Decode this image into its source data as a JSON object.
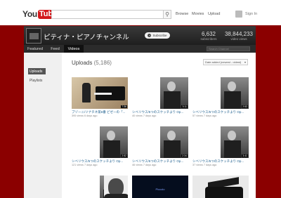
{
  "topbar": {
    "logo_you": "You",
    "logo_tube": "Tube",
    "search_placeholder": "",
    "nav": [
      "Browse",
      "Movies",
      "Upload"
    ],
    "signin": "Sign In"
  },
  "channel": {
    "title": "ピティナ・ピアノチャンネル",
    "subscribe_label": "Subscribe",
    "stats": [
      {
        "value": "6,632",
        "label": "subscribers"
      },
      {
        "value": "38,844,233",
        "label": "video views"
      }
    ],
    "tabs": [
      "Featured",
      "Feed",
      "Videos"
    ],
    "active_tab": "Videos",
    "search_placeholder": "Search Channel"
  },
  "sidebar": {
    "items": [
      "Uploads",
      "Playlists"
    ],
    "active": "Uploads"
  },
  "main": {
    "title": "Uploads",
    "count": "(5,186)",
    "sort_label": "Date added (newest - oldest)"
  },
  "videos": [
    {
      "title": "ブゾーニ/ソナチネ第6番 ビゼーの「...",
      "views": "395 views",
      "age": "6 days ago",
      "duration": "7:36",
      "thumb": "piano"
    },
    {
      "title": "シベリウス/5つのスケッチより Op...",
      "views": "40 views",
      "age": "7 days ago",
      "duration": "3:11",
      "thumb": "split"
    },
    {
      "title": "シベリウス/5つのスケッチより Op...",
      "views": "57 views",
      "age": "7 days ago",
      "duration": "2:53",
      "thumb": "split"
    },
    {
      "title": "シベリウス/5つのスケッチより Op...",
      "views": "121 views",
      "age": "7 days ago",
      "duration": "2:52",
      "thumb": "split"
    },
    {
      "title": "シベリウス/5つのスケッチより Op...",
      "views": "46 views",
      "age": "7 days ago",
      "duration": "2:34",
      "thumb": "split"
    },
    {
      "title": "シベリウス/5つのスケッチより Op...",
      "views": "37 views",
      "age": "7 days ago",
      "duration": "3:41",
      "thumb": "split"
    },
    {
      "title": "",
      "views": "",
      "age": "",
      "duration": "",
      "thumb": "split"
    },
    {
      "title": "",
      "views": "",
      "age": "",
      "duration": "",
      "thumb": "portrait"
    },
    {
      "title": "",
      "views": "",
      "age": "",
      "duration": "",
      "thumb": "dark",
      "thumb_text": "Piccolo"
    },
    {
      "title": "",
      "views": "",
      "age": "",
      "duration": "",
      "thumb": "grand"
    }
  ]
}
